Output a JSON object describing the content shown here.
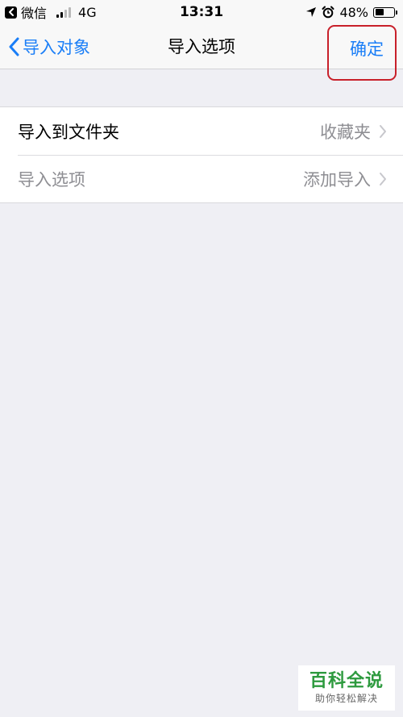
{
  "status_bar": {
    "app": "微信",
    "network": "4G",
    "time": "13:31",
    "battery": "48%",
    "battery_level": 0.48,
    "signal_bars": 2,
    "signal_total": 4
  },
  "nav": {
    "back_label": "导入对象",
    "title": "导入选项",
    "confirm_label": "确定",
    "accent": "#1a7ef7",
    "highlight": "#c8202a"
  },
  "list": {
    "rows": [
      {
        "label": "导入到文件夹",
        "value": "收藏夹"
      },
      {
        "label": "导入选项",
        "value": "添加导入"
      }
    ]
  },
  "watermark": {
    "title": "百科全说",
    "subtitle": "助你轻松解决"
  }
}
